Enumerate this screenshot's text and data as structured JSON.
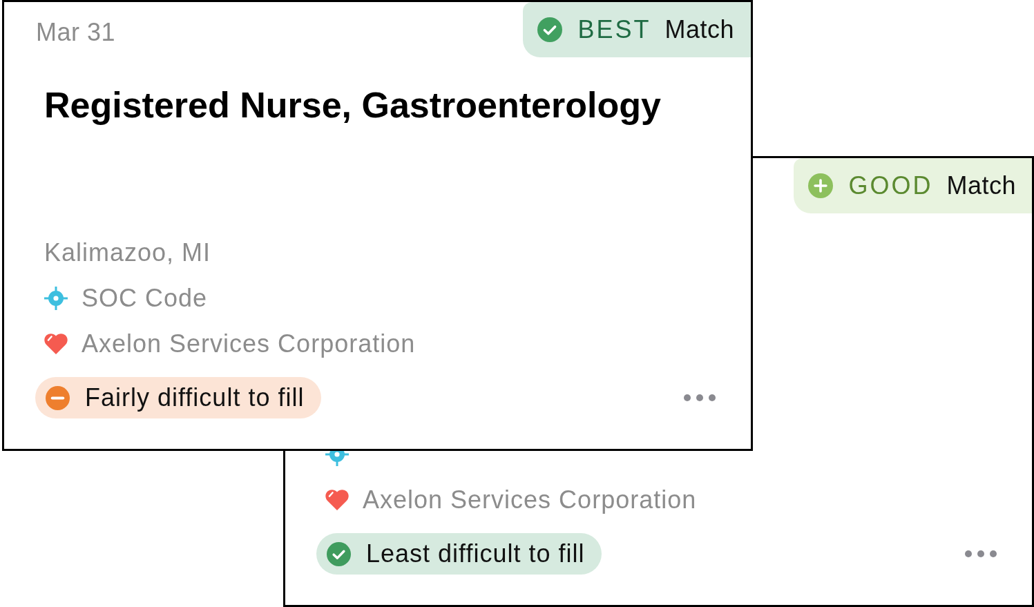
{
  "cards": [
    {
      "date": "Mar 31",
      "match": {
        "kind": "best",
        "tier": "BEST",
        "label": "Match"
      },
      "title": "Registered Nurse, Gastroenterology",
      "location": "Kalimazoo, MI",
      "details": [
        {
          "kind": "soc",
          "text": "SOC Code"
        },
        {
          "kind": "company",
          "text": "Axelon Services Corporation"
        }
      ],
      "difficulty": {
        "kind": "medium",
        "label": "Fairly difficult to fill"
      }
    },
    {
      "match": {
        "kind": "good",
        "tier": "GOOD",
        "label": "Match"
      },
      "details": [
        {
          "kind": "soc"
        },
        {
          "kind": "company",
          "text": "Axelon Services Corporation"
        }
      ],
      "difficulty": {
        "kind": "low",
        "label": "Least difficult to fill"
      }
    }
  ]
}
